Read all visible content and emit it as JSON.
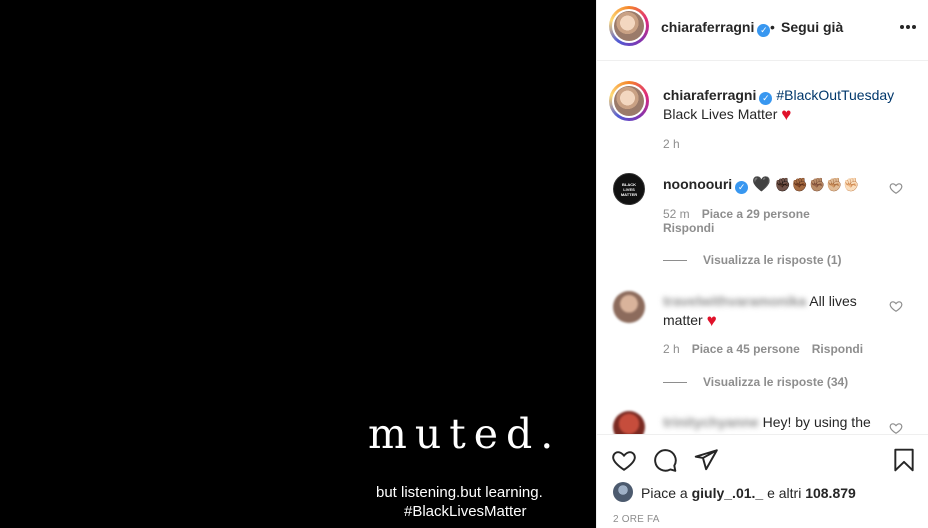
{
  "post_image": {
    "headline": "muted.",
    "line1": "but listening.but learning.",
    "line2": "#BlackLivesMatter"
  },
  "header": {
    "username": "chiaraferragni",
    "separator": "•",
    "follow_status": "Segui già"
  },
  "caption": {
    "username": "chiaraferragni",
    "hashtag": "#BlackOutTuesday",
    "text": "Black Lives Matter",
    "time": "2 h"
  },
  "comments": [
    {
      "username": "noonoouri",
      "emojis": "✊🏿✊🏾✊🏽✊🏼✊🏻",
      "time": "52 m",
      "likes": "Piace a 29 persone",
      "reply": "Rispondi",
      "view_replies": "Visualizza le risposte (1)"
    },
    {
      "username": "travelwithvaramonika",
      "text_line1": "All lives",
      "text_line2": "matter",
      "time": "2 h",
      "likes": "Piace a 45 persone",
      "reply": "Rispondi",
      "view_replies": "Visualizza le risposte (34)"
    },
    {
      "username": "trinitychyanne",
      "text": "Hey! by using the"
    }
  ],
  "actions": {
    "likes_prefix": "Piace a",
    "likes_user": "giuly_.01._",
    "likes_suffix": "e altri",
    "likes_count": "108.879",
    "time_ago": "2 ORE FA"
  },
  "colors": {
    "verified": "#3897f0",
    "hashtag": "#00376b",
    "heart": "#e0112a",
    "secondary_text": "#8e8e8e"
  }
}
